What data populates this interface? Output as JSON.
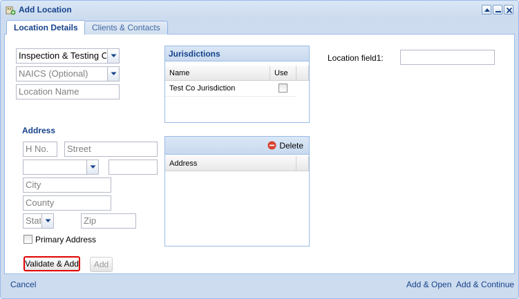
{
  "window": {
    "title": "Add Location"
  },
  "tabs": [
    {
      "label": "Location Details",
      "active": true
    },
    {
      "label": "Clients & Contacts",
      "active": false
    }
  ],
  "details": {
    "inspection_combo_value": "Inspection & Testing Co",
    "naics_placeholder": "NAICS (Optional)",
    "location_name_placeholder": "Location Name"
  },
  "jurisdictions": {
    "title": "Jurisdictions",
    "columns": [
      "Name",
      "Use"
    ],
    "rows": [
      {
        "name": "Test Co Jurisdiction",
        "use": false
      }
    ]
  },
  "location_field": {
    "label": "Location field1:",
    "value": ""
  },
  "address": {
    "section_label": "Address",
    "house_no_placeholder": "H No.",
    "street_placeholder": "Street",
    "city_placeholder": "City",
    "county_placeholder": "County",
    "state_placeholder": "State",
    "zip_placeholder": "Zip",
    "primary_label": "Primary Address",
    "validate_add_label": "Validate & Add",
    "add_label": "Add"
  },
  "address_grid": {
    "delete_label": "Delete",
    "column": "Address"
  },
  "footer": {
    "cancel_label": "Cancel",
    "add_open_label": "Add & Open",
    "add_continue_label": "Add & Continue"
  },
  "colors": {
    "accent": "#15428b",
    "highlight": "#e00000"
  }
}
